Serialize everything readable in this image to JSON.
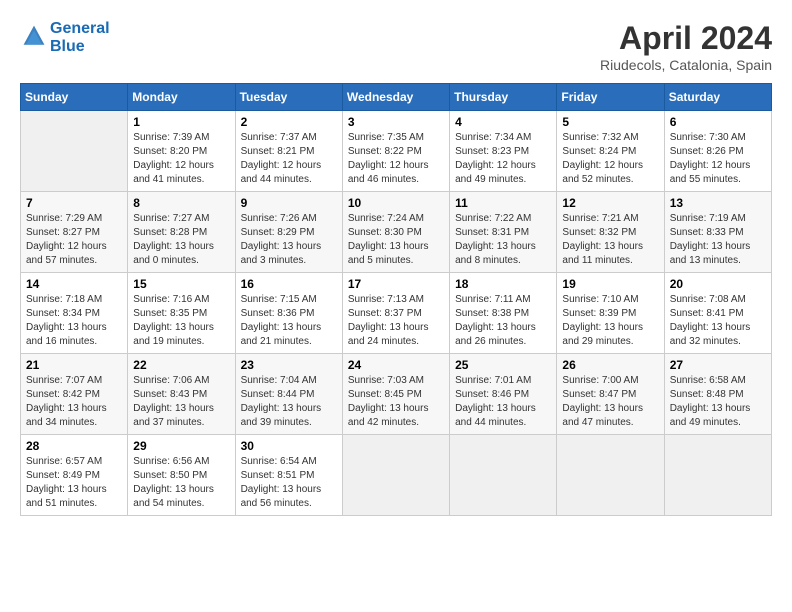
{
  "header": {
    "logo_line1": "General",
    "logo_line2": "Blue",
    "month_title": "April 2024",
    "location": "Riudecols, Catalonia, Spain"
  },
  "weekdays": [
    "Sunday",
    "Monday",
    "Tuesday",
    "Wednesday",
    "Thursday",
    "Friday",
    "Saturday"
  ],
  "weeks": [
    [
      {
        "day": "",
        "info": ""
      },
      {
        "day": "1",
        "info": "Sunrise: 7:39 AM\nSunset: 8:20 PM\nDaylight: 12 hours\nand 41 minutes."
      },
      {
        "day": "2",
        "info": "Sunrise: 7:37 AM\nSunset: 8:21 PM\nDaylight: 12 hours\nand 44 minutes."
      },
      {
        "day": "3",
        "info": "Sunrise: 7:35 AM\nSunset: 8:22 PM\nDaylight: 12 hours\nand 46 minutes."
      },
      {
        "day": "4",
        "info": "Sunrise: 7:34 AM\nSunset: 8:23 PM\nDaylight: 12 hours\nand 49 minutes."
      },
      {
        "day": "5",
        "info": "Sunrise: 7:32 AM\nSunset: 8:24 PM\nDaylight: 12 hours\nand 52 minutes."
      },
      {
        "day": "6",
        "info": "Sunrise: 7:30 AM\nSunset: 8:26 PM\nDaylight: 12 hours\nand 55 minutes."
      }
    ],
    [
      {
        "day": "7",
        "info": "Sunrise: 7:29 AM\nSunset: 8:27 PM\nDaylight: 12 hours\nand 57 minutes."
      },
      {
        "day": "8",
        "info": "Sunrise: 7:27 AM\nSunset: 8:28 PM\nDaylight: 13 hours\nand 0 minutes."
      },
      {
        "day": "9",
        "info": "Sunrise: 7:26 AM\nSunset: 8:29 PM\nDaylight: 13 hours\nand 3 minutes."
      },
      {
        "day": "10",
        "info": "Sunrise: 7:24 AM\nSunset: 8:30 PM\nDaylight: 13 hours\nand 5 minutes."
      },
      {
        "day": "11",
        "info": "Sunrise: 7:22 AM\nSunset: 8:31 PM\nDaylight: 13 hours\nand 8 minutes."
      },
      {
        "day": "12",
        "info": "Sunrise: 7:21 AM\nSunset: 8:32 PM\nDaylight: 13 hours\nand 11 minutes."
      },
      {
        "day": "13",
        "info": "Sunrise: 7:19 AM\nSunset: 8:33 PM\nDaylight: 13 hours\nand 13 minutes."
      }
    ],
    [
      {
        "day": "14",
        "info": "Sunrise: 7:18 AM\nSunset: 8:34 PM\nDaylight: 13 hours\nand 16 minutes."
      },
      {
        "day": "15",
        "info": "Sunrise: 7:16 AM\nSunset: 8:35 PM\nDaylight: 13 hours\nand 19 minutes."
      },
      {
        "day": "16",
        "info": "Sunrise: 7:15 AM\nSunset: 8:36 PM\nDaylight: 13 hours\nand 21 minutes."
      },
      {
        "day": "17",
        "info": "Sunrise: 7:13 AM\nSunset: 8:37 PM\nDaylight: 13 hours\nand 24 minutes."
      },
      {
        "day": "18",
        "info": "Sunrise: 7:11 AM\nSunset: 8:38 PM\nDaylight: 13 hours\nand 26 minutes."
      },
      {
        "day": "19",
        "info": "Sunrise: 7:10 AM\nSunset: 8:39 PM\nDaylight: 13 hours\nand 29 minutes."
      },
      {
        "day": "20",
        "info": "Sunrise: 7:08 AM\nSunset: 8:41 PM\nDaylight: 13 hours\nand 32 minutes."
      }
    ],
    [
      {
        "day": "21",
        "info": "Sunrise: 7:07 AM\nSunset: 8:42 PM\nDaylight: 13 hours\nand 34 minutes."
      },
      {
        "day": "22",
        "info": "Sunrise: 7:06 AM\nSunset: 8:43 PM\nDaylight: 13 hours\nand 37 minutes."
      },
      {
        "day": "23",
        "info": "Sunrise: 7:04 AM\nSunset: 8:44 PM\nDaylight: 13 hours\nand 39 minutes."
      },
      {
        "day": "24",
        "info": "Sunrise: 7:03 AM\nSunset: 8:45 PM\nDaylight: 13 hours\nand 42 minutes."
      },
      {
        "day": "25",
        "info": "Sunrise: 7:01 AM\nSunset: 8:46 PM\nDaylight: 13 hours\nand 44 minutes."
      },
      {
        "day": "26",
        "info": "Sunrise: 7:00 AM\nSunset: 8:47 PM\nDaylight: 13 hours\nand 47 minutes."
      },
      {
        "day": "27",
        "info": "Sunrise: 6:58 AM\nSunset: 8:48 PM\nDaylight: 13 hours\nand 49 minutes."
      }
    ],
    [
      {
        "day": "28",
        "info": "Sunrise: 6:57 AM\nSunset: 8:49 PM\nDaylight: 13 hours\nand 51 minutes."
      },
      {
        "day": "29",
        "info": "Sunrise: 6:56 AM\nSunset: 8:50 PM\nDaylight: 13 hours\nand 54 minutes."
      },
      {
        "day": "30",
        "info": "Sunrise: 6:54 AM\nSunset: 8:51 PM\nDaylight: 13 hours\nand 56 minutes."
      },
      {
        "day": "",
        "info": ""
      },
      {
        "day": "",
        "info": ""
      },
      {
        "day": "",
        "info": ""
      },
      {
        "day": "",
        "info": ""
      }
    ]
  ]
}
